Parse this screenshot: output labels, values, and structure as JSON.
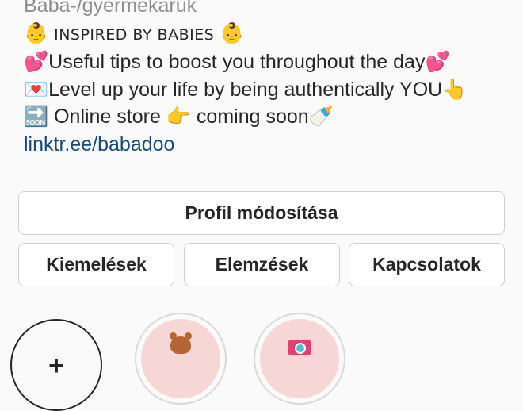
{
  "profile": {
    "category": "Baba-/gyermekáruk",
    "bio": {
      "line1": {
        "emoji_left": "👶",
        "text": "INSPIRED BY BABIES",
        "emoji_right": "👶"
      },
      "line2": {
        "emoji_left": "💕",
        "text": "Useful tips to boost you throughout the day",
        "emoji_right": "💕"
      },
      "line3": {
        "emoji_left": "💌",
        "text": "Level up your life by being authentically YOU",
        "emoji_right": "👆"
      },
      "line4": {
        "emoji_left": "🔜",
        "text_before": "Online store ",
        "emoji_mid": "👉",
        "text_after": " coming soon",
        "emoji_right": "🍼"
      }
    },
    "link": "linktr.ee/babadoo"
  },
  "actions": {
    "edit_profile": "Profil módosítása",
    "highlights": "Kiemelések",
    "insights": "Elemzések",
    "contacts": "Kapcsolatok"
  },
  "story_highlights": {
    "new_icon": "+",
    "items": [
      {
        "icon": "teddy-bear-icon",
        "ring_color": "#f7d6d6"
      },
      {
        "icon": "camera-icon",
        "ring_color": "#f7d6d6"
      }
    ]
  },
  "colors": {
    "link": "#1a4b78",
    "muted": "#8e8e8e",
    "button_border": "#cfcfcf"
  }
}
